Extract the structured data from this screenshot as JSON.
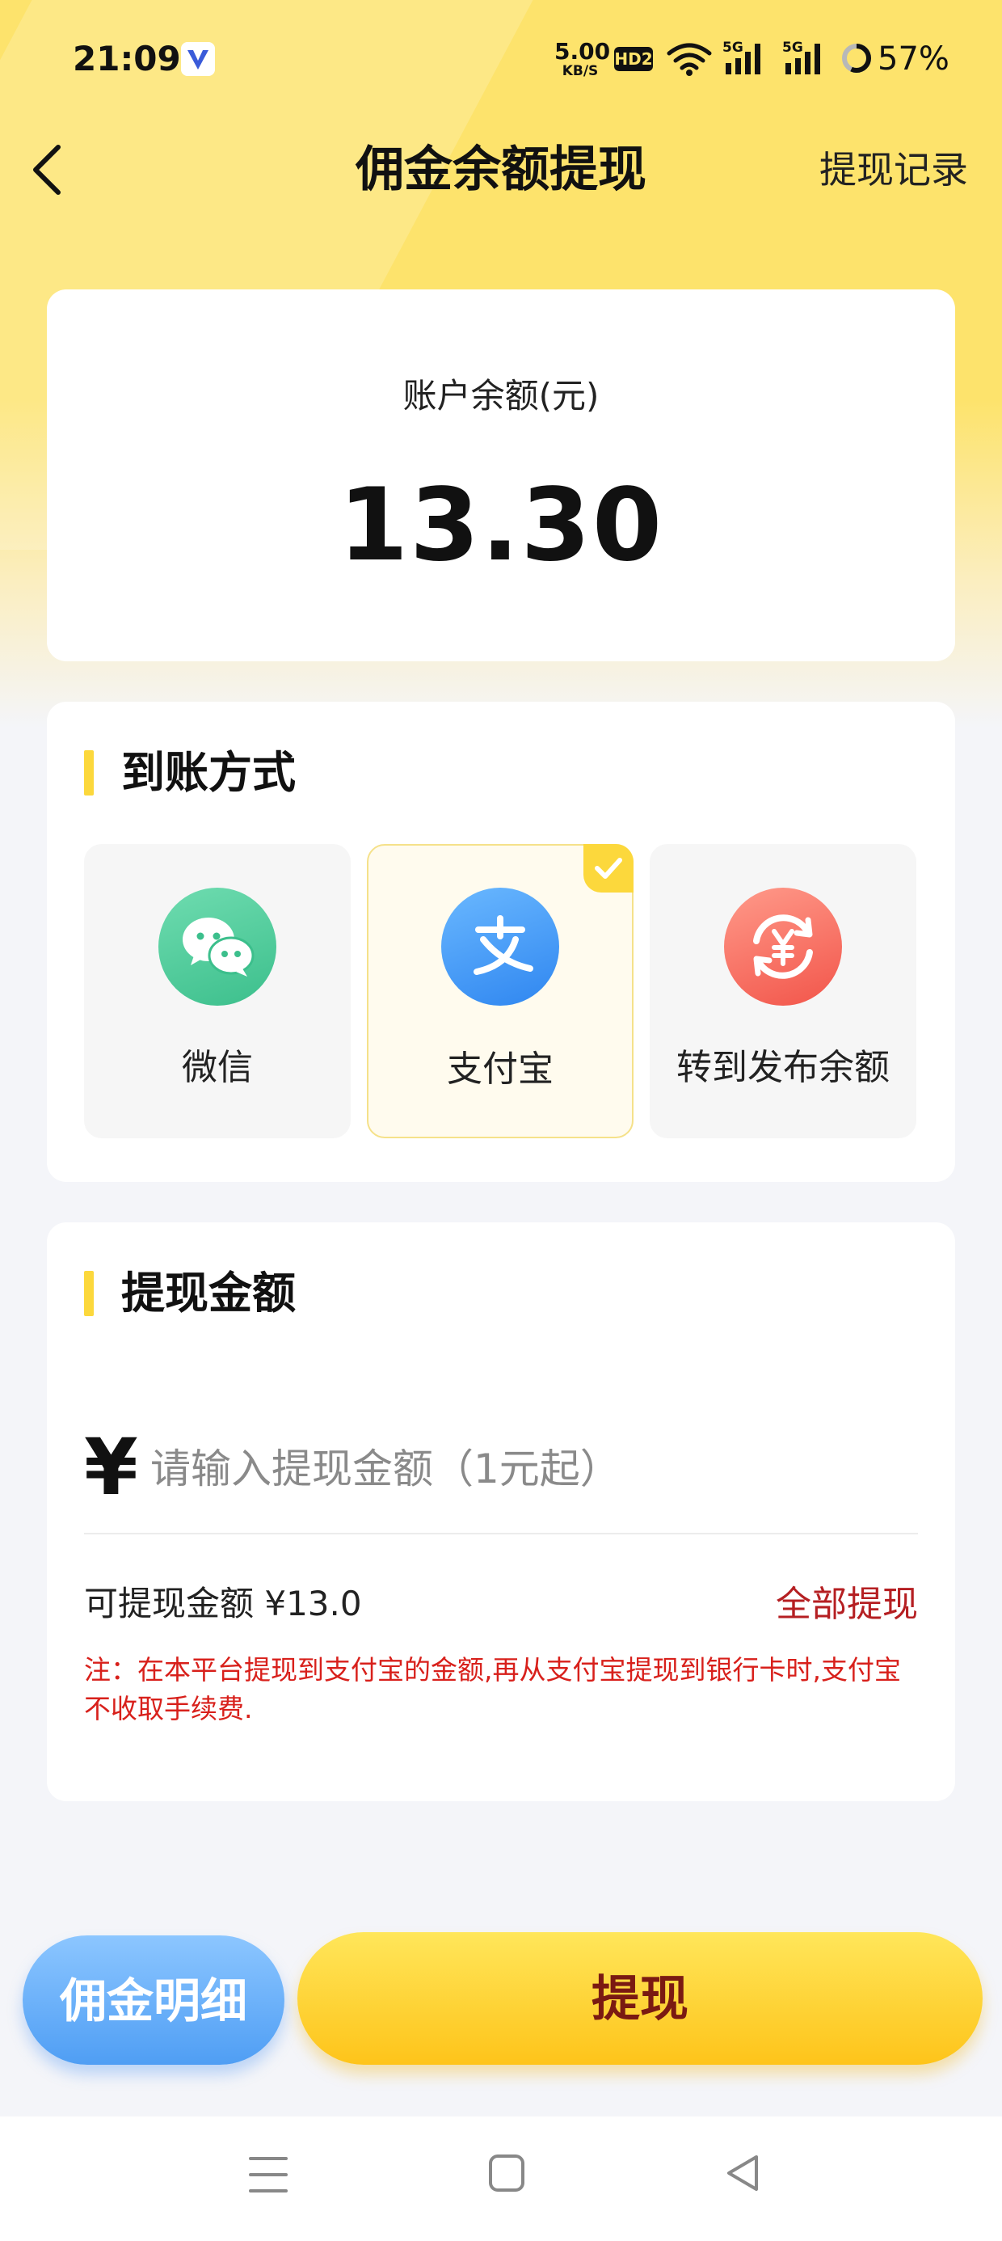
{
  "status_bar": {
    "time": "21:09",
    "net_speed_value": "5.00",
    "net_speed_unit": "KB/S",
    "hd_badge": "HD2",
    "signal_1_label": "5G",
    "signal_2_label": "5G",
    "battery": "57%",
    "battery_level": 0.57
  },
  "nav": {
    "title": "佣金余额提现",
    "record_link": "提现记录"
  },
  "balance": {
    "label": "账户余额(元)",
    "value": "13.30"
  },
  "methods": {
    "title": "到账方式",
    "options": [
      {
        "label": "微信",
        "icon": "wechat-icon",
        "selected": false
      },
      {
        "label": "支付宝",
        "icon": "alipay-icon",
        "selected": true
      },
      {
        "label": "转到发布余额",
        "icon": "yuan-transfer-icon",
        "selected": false
      }
    ]
  },
  "amount": {
    "title": "提现金额",
    "currency_symbol": "¥",
    "placeholder": "请输入提现金额（1元起）",
    "available_text": "可提现金额 ¥13.0",
    "withdraw_all": "全部提现",
    "note": "注：在本平台提现到支付宝的金额,再从支付宝提现到银行卡时,支付宝不收取手续费."
  },
  "actions": {
    "details_label": "佣金明细",
    "withdraw_label": "提现"
  },
  "colors": {
    "header_yellow": "#fde36c",
    "accent_yellow": "#fcd83c",
    "withdraw_text": "#7a1a12",
    "link_red": "#b51f22",
    "note_red": "#d8201b",
    "details_blue": "#4f9ef4"
  }
}
